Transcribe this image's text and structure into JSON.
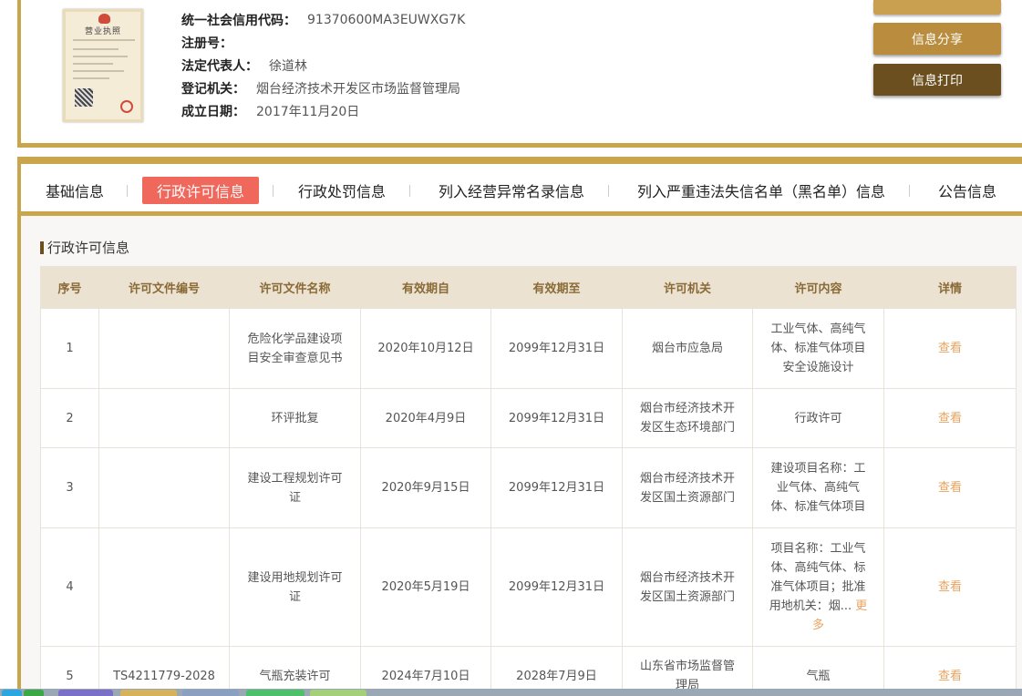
{
  "company": {
    "license_image": {
      "title": "营业执照"
    },
    "fields": [
      {
        "label": "统一社会信用代码：",
        "value": "91370600MA3EUWXG7K"
      },
      {
        "label": "注册号：",
        "value": ""
      },
      {
        "label": "法定代表人：",
        "value": "徐道林"
      },
      {
        "label": "登记机关：",
        "value": "烟台经济技术开发区市场监督管理局"
      },
      {
        "label": "成立日期：",
        "value": "2017年11月20日"
      }
    ],
    "buttons": {
      "share": "信息分享",
      "print": "信息打印"
    }
  },
  "tabs": [
    {
      "label": "基础信息",
      "active": false
    },
    {
      "label": "行政许可信息",
      "active": true
    },
    {
      "label": "行政处罚信息",
      "active": false
    },
    {
      "label": "列入经营异常名录信息",
      "active": false
    },
    {
      "label": "列入严重违法失信名单（黑名单）信息",
      "active": false
    },
    {
      "label": "公告信息",
      "active": false
    }
  ],
  "section_title": "行政许可信息",
  "table": {
    "headers": [
      "序号",
      "许可文件编号",
      "许可文件名称",
      "有效期自",
      "有效期至",
      "许可机关",
      "许可内容",
      "详情"
    ],
    "rows": [
      {
        "no": "1",
        "doc_no": "",
        "name": "危险化学品建设项目安全审查意见书",
        "from": "2020年10月12日",
        "to": "2099年12月31日",
        "authority": "烟台市应急局",
        "content": "工业气体、高纯气体、标准气体项目安全设施设计",
        "more": "",
        "detail": "查看"
      },
      {
        "no": "2",
        "doc_no": "",
        "name": "环评批复",
        "from": "2020年4月9日",
        "to": "2099年12月31日",
        "authority": "烟台市经济技术开发区生态环境部门",
        "content": "行政许可",
        "more": "",
        "detail": "查看"
      },
      {
        "no": "3",
        "doc_no": "",
        "name": "建设工程规划许可证",
        "from": "2020年9月15日",
        "to": "2099年12月31日",
        "authority": "烟台市经济技术开发区国土资源部门",
        "content": "建设项目名称：工业气体、高纯气体、标准气体项目",
        "more": "",
        "detail": "查看"
      },
      {
        "no": "4",
        "doc_no": "",
        "name": "建设用地规划许可证",
        "from": "2020年5月19日",
        "to": "2099年12月31日",
        "authority": "烟台市经济技术开发区国土资源部门",
        "content": "项目名称：工业气体、高纯气体、标准气体项目；批准用地机关：烟...",
        "more": "更多",
        "detail": "查看"
      },
      {
        "no": "5",
        "doc_no": "TS4211779-2028",
        "name": "气瓶充装许可",
        "from": "2024年7月10日",
        "to": "2028年7月9日",
        "authority": "山东省市场监督管理局",
        "content": "气瓶",
        "more": "",
        "detail": "查看"
      }
    ]
  },
  "colors": {
    "gold": "#c9a54c",
    "share_button": "#b98c3e",
    "print_button": "#6b4f1e",
    "active_tab": "#f0675c",
    "header_bg": "#ebe2d1",
    "link": "#e8a35f"
  }
}
